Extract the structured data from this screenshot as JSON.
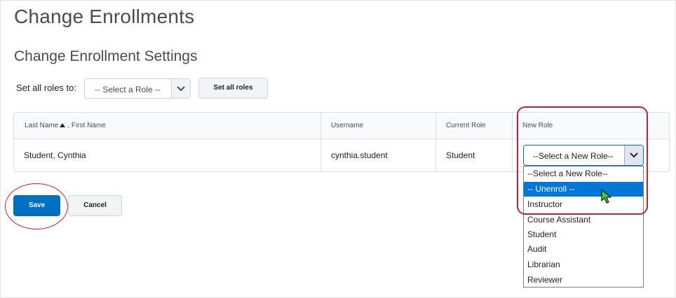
{
  "page": {
    "title": "Change Enrollments",
    "section_title": "Change Enrollment Settings"
  },
  "set_all": {
    "label": "Set all roles to:",
    "select_value": "-- Select a Role --",
    "button_label": "Set all roles"
  },
  "table": {
    "headers": {
      "last_name": "Last Name",
      "first_name": ", First Name",
      "username": "Username",
      "current_role": "Current Role",
      "new_role": "New Role"
    },
    "rows": [
      {
        "name": "Student, Cynthia",
        "username": "cynthia.student",
        "current_role": "Student",
        "new_role": "--Select a New Role--"
      }
    ]
  },
  "new_role_dropdown": {
    "options": [
      "--Select a New Role--",
      "-- Unenroll --",
      "Instructor",
      "Course Assistant",
      "Student",
      "Audit",
      "Librarian",
      "Reviewer"
    ],
    "highlighted": "-- Unenroll --"
  },
  "actions": {
    "save_label": "Save",
    "cancel_label": "Cancel"
  },
  "colors": {
    "primary": "#006fbf",
    "highlight": "#0078d7",
    "annotation": "#c0203b",
    "cursor": "#3fc93f"
  },
  "icons": [
    "chevron-down-icon",
    "sort-ascending-icon",
    "mouse-cursor-icon"
  ]
}
